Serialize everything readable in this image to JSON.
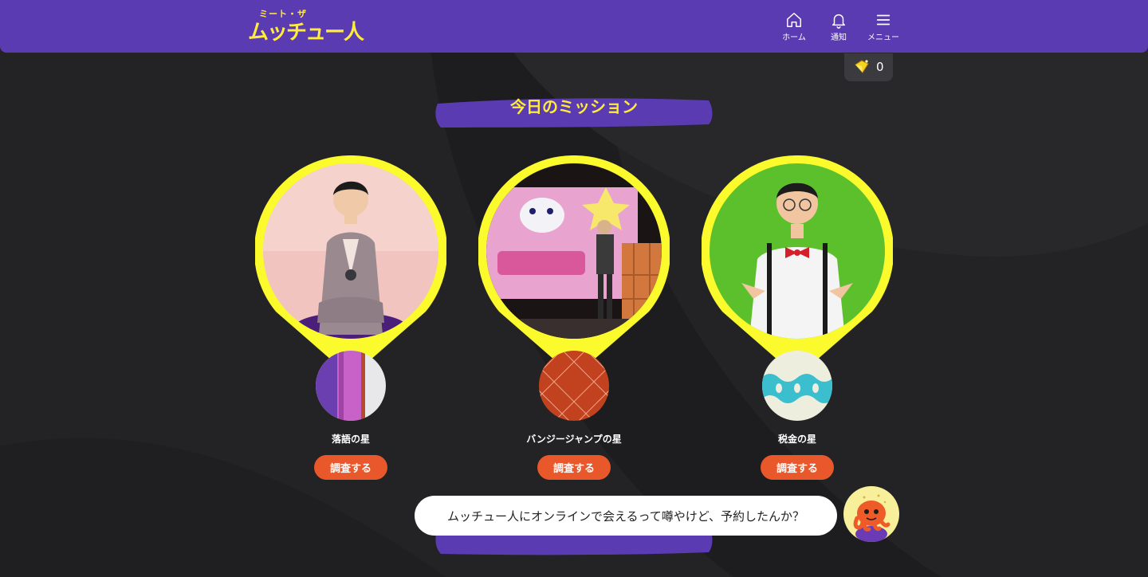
{
  "header": {
    "logo_top": "ミート・ザ",
    "logo_main": "ムッチュー人",
    "nav": [
      {
        "label": "ホーム",
        "icon": "home-icon"
      },
      {
        "label": "通知",
        "icon": "bell-icon"
      },
      {
        "label": "メニュー",
        "icon": "menu-icon"
      }
    ]
  },
  "coins": {
    "count": "0",
    "icon": "coin-icon"
  },
  "mission": {
    "title": "今日のミッション",
    "items": [
      {
        "planet": "落語の星",
        "button": "調査する",
        "planet_icon": "striped-planet-icon"
      },
      {
        "planet": "バンジージャンプの星",
        "button": "調査する",
        "planet_icon": "crosshatch-planet-icon"
      },
      {
        "planet": "税金の星",
        "button": "調査する",
        "planet_icon": "wave-planet-icon"
      }
    ]
  },
  "chat": {
    "message": "ムッチュー人にオンラインで会えるって噂やけど、予約したんか？",
    "avatar_icon": "octopus-mascot-icon"
  },
  "colors": {
    "header": "#5a3bb1",
    "accent_yellow": "#ffec3a",
    "pin_yellow": "#fafa2c",
    "button_orange": "#e8582b",
    "background": "#232325"
  }
}
